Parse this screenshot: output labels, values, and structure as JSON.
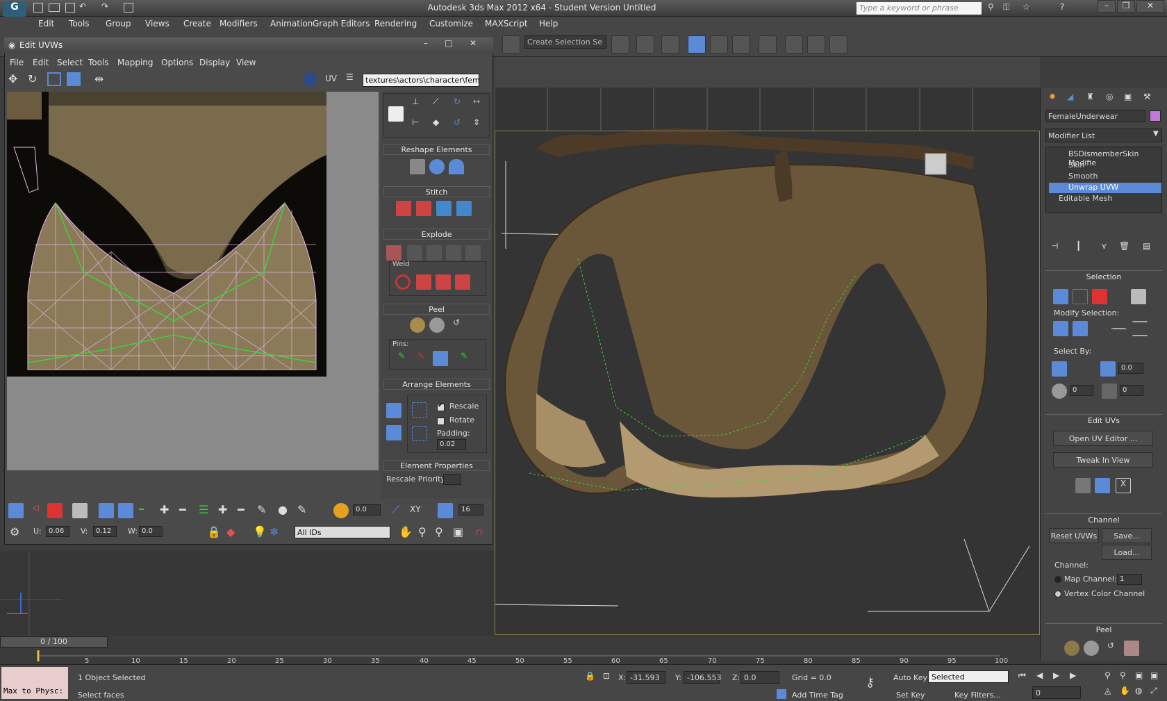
{
  "app": {
    "title": "Autodesk 3ds Max 2012 x64  -  Student Version   Untitled",
    "search_placeholder": "Type a keyword or phrase"
  },
  "menus": [
    "Edit",
    "Tools",
    "Group",
    "Views",
    "Create",
    "Modifiers",
    "Animation",
    "Graph Editors",
    "Rendering",
    "Customize",
    "MAXScript",
    "Help"
  ],
  "toolbar": {
    "selection_set": "Create Selection Se"
  },
  "uvw": {
    "title": "Edit UVWs",
    "menus": [
      "File",
      "Edit",
      "Select",
      "Tools",
      "Mapping",
      "Options",
      "Display",
      "View"
    ],
    "uv_label": "UV",
    "texture": "textures\\actors\\character\\fem",
    "rollouts": {
      "reshape": "Reshape Elements",
      "stitch": "Stitch",
      "explode": "Explode",
      "weld": "Weld",
      "peel": "Peel",
      "pins": "Pins:",
      "arrange": "Arrange Elements",
      "rescale": "Rescale",
      "rotate": "Rotate",
      "padding_label": "Padding:",
      "padding": "0.02",
      "element_props": "Element Properties",
      "rescale_priority": "Rescale Priority:"
    },
    "bottom": {
      "threshold": "0.0",
      "xy": "XY",
      "grid_count": "16",
      "u_label": "U:",
      "u": "0.06",
      "v_label": "V:",
      "v": "0.12",
      "w_label": "W:",
      "w": "0.0",
      "ids": "All IDs"
    }
  },
  "command_panel": {
    "object_name": "FemaleUnderwear",
    "modifier_list": "Modifier List",
    "stack": [
      "BSDismemberSkin Modifie",
      "Skin",
      "Smooth",
      "Unwrap UVW",
      "Editable Mesh"
    ],
    "selection": "Selection",
    "modify_selection": "Modify Selection:",
    "select_by": "Select By:",
    "angle": "0.0",
    "spin1": "0",
    "spin2": "0",
    "edit_uvs": "Edit UVs",
    "open_uv_editor": "Open UV Editor ...",
    "tweak_in_view": "Tweak In View",
    "channel": "Channel",
    "reset_uvws": "Reset UVWs",
    "save": "Save...",
    "load": "Load...",
    "channel_label": "Channel:",
    "map_channel": "Map Channel:",
    "map_channel_value": "1",
    "vertex_color_channel": "Vertex Color Channel",
    "peel": "Peel"
  },
  "timeline": {
    "frame": "0 / 100",
    "ticks": [
      "5",
      "10",
      "15",
      "20",
      "25",
      "30",
      "35",
      "40",
      "45",
      "50",
      "55",
      "60",
      "65",
      "70",
      "75",
      "80",
      "85",
      "90",
      "95",
      "100"
    ]
  },
  "status": {
    "maxscript": "Max to Physc:",
    "objects": "1 Object Selected",
    "prompt": "Select faces",
    "x_label": "X:",
    "x": "-31.593",
    "y_label": "Y:",
    "y": "-106.553",
    "z_label": "Z:",
    "z": "0.0",
    "grid": "Grid = 0.0",
    "add_time_tag": "Add Time Tag",
    "auto_key": "Auto Key",
    "set_key": "Set Key",
    "selected": "Selected",
    "key_filters": "Key Filters...",
    "frame_field": "0"
  },
  "colors": {
    "accent": "#5b8bd8",
    "mesh_wire": "#e8b8f0",
    "seam": "#3ed23e"
  }
}
